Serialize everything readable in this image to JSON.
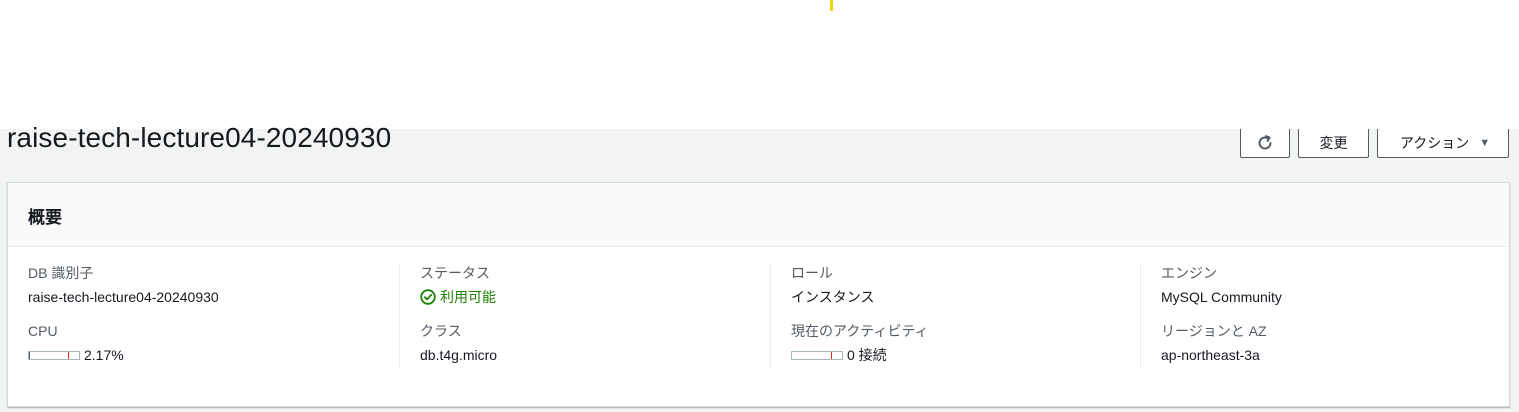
{
  "page": {
    "title": "raise-tech-lecture04-20240930"
  },
  "toolbar": {
    "refresh_icon": "refresh-icon",
    "modify_label": "変更",
    "actions_label": "アクション",
    "actions_caret": "▼"
  },
  "summary": {
    "title": "概要",
    "columns": [
      {
        "fields": [
          {
            "label": "DB 識別子",
            "value": "raise-tech-lecture04-20240930"
          },
          {
            "label": "CPU",
            "value": "2.17%",
            "meter_fraction": 0.0217
          }
        ]
      },
      {
        "fields": [
          {
            "label": "ステータス",
            "value": "利用可能",
            "status_color": "#1d8102",
            "icon": "check-circle-icon"
          },
          {
            "label": "クラス",
            "value": "db.t4g.micro"
          }
        ]
      },
      {
        "fields": [
          {
            "label": "ロール",
            "value": "インスタンス"
          },
          {
            "label": "現在のアクティビティ",
            "value": "0 接続",
            "meter_fraction": 0
          }
        ]
      },
      {
        "fields": [
          {
            "label": "エンジン",
            "value": "MySQL Community"
          },
          {
            "label": "リージョンと AZ",
            "value": "ap-northeast-3a"
          }
        ]
      }
    ]
  }
}
